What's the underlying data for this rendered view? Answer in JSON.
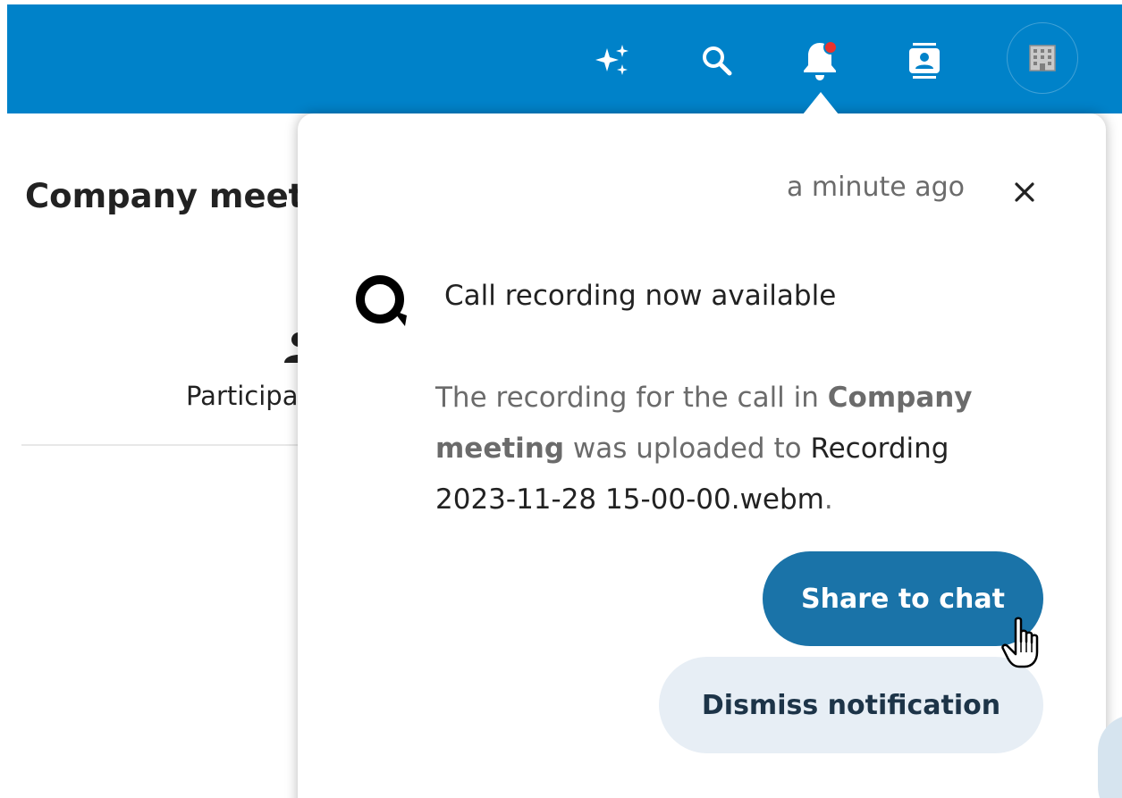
{
  "header": {
    "background_color": "#0082c9",
    "icons": [
      {
        "name": "assistant-sparkles-icon"
      },
      {
        "name": "search-icon"
      },
      {
        "name": "notifications-bell-icon",
        "has_unread_badge": true
      },
      {
        "name": "contacts-icon"
      },
      {
        "name": "avatar-building-icon"
      }
    ],
    "badge_color": "#e9322d"
  },
  "conversation": {
    "title": "Company meeting",
    "participants_label": "Participants"
  },
  "notification": {
    "timestamp": "a minute ago",
    "close_icon": "close-icon",
    "app_icon": "talk-app-icon",
    "subject": "Call recording now available",
    "message": {
      "prefix": "The recording for the call in ",
      "room_name": "Company meeting",
      "middle": " was uploaded to ",
      "file_name": "Recording 2023-11-28 15-00-00.webm",
      "suffix": "."
    },
    "primary_action": "Share to chat",
    "secondary_action": "Dismiss notification",
    "primary_color": "#1a73a8",
    "secondary_color": "#e7eef5"
  }
}
